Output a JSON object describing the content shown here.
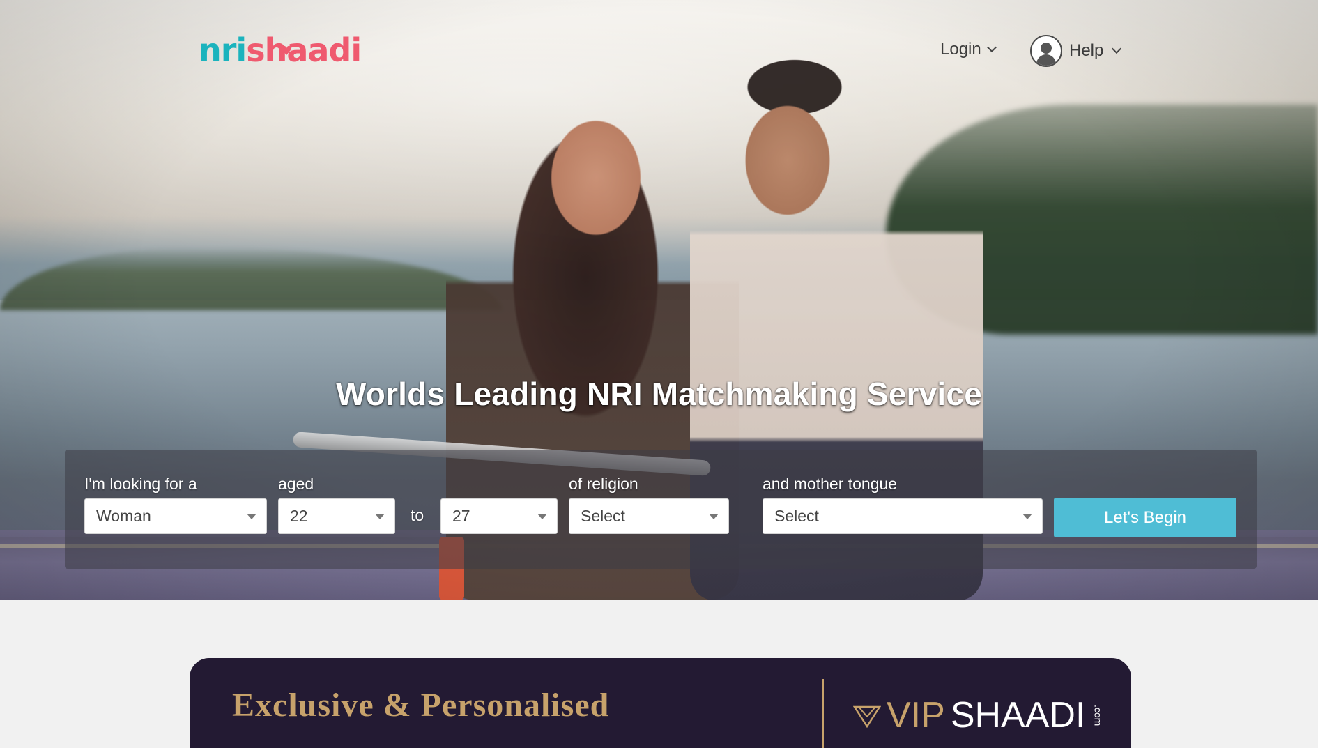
{
  "header": {
    "logo": {
      "part1": "nri",
      "part2": "shaadi"
    },
    "login_label": "Login",
    "help_label": "Help"
  },
  "hero": {
    "headline": "Worlds Leading NRI Matchmaking Service"
  },
  "search": {
    "looking_for_label": "I'm looking for a",
    "looking_for_value": "Woman",
    "aged_label": "aged",
    "age_from_value": "22",
    "to_label": "to",
    "age_to_value": "27",
    "religion_label": "of religion",
    "religion_value": "Select",
    "mother_tongue_label": "and mother tongue",
    "mother_tongue_value": "Select",
    "submit_label": "Let's Begin"
  },
  "vip_banner": {
    "title": "Exclusive & Personalised",
    "logo": {
      "vip": "VIP",
      "shaadi": "SHAADI",
      "suffix": ".com"
    }
  },
  "colors": {
    "brand_teal": "#1bb3bd",
    "brand_pink": "#ef5a6f",
    "button": "#4fbdd5",
    "vip_bg": "#231a33",
    "vip_gold": "#c7a26b"
  },
  "icons": {
    "login_chevron": "chevron-down-icon",
    "help_avatar": "user-avatar-icon",
    "help_chevron": "chevron-down-icon",
    "select_caret": "caret-down-icon",
    "vip_diamond": "diamond-icon"
  }
}
